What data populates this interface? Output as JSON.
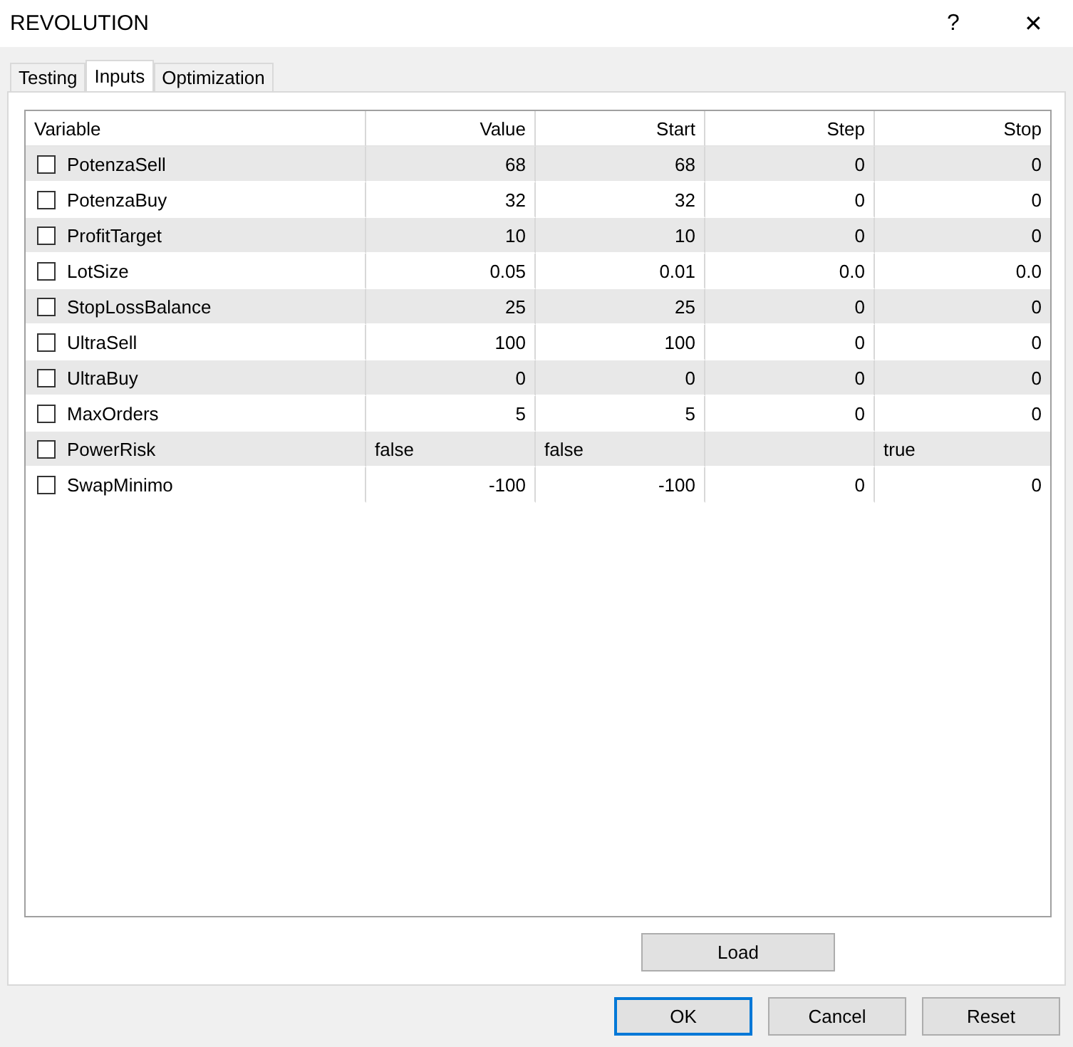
{
  "window": {
    "title": "REVOLUTION",
    "help": "?",
    "close": "✕"
  },
  "tabs": [
    {
      "label": "Testing",
      "selected": false
    },
    {
      "label": "Inputs",
      "selected": true
    },
    {
      "label": "Optimization",
      "selected": false
    }
  ],
  "table": {
    "columns": [
      "Variable",
      "Value",
      "Start",
      "Step",
      "Stop"
    ],
    "rows": [
      {
        "kind": "number",
        "checked": false,
        "variable": "PotenzaSell",
        "value": "68",
        "start": "68",
        "step": "0",
        "stop": "0"
      },
      {
        "kind": "number",
        "checked": false,
        "variable": "PotenzaBuy",
        "value": "32",
        "start": "32",
        "step": "0",
        "stop": "0"
      },
      {
        "kind": "number",
        "checked": false,
        "variable": "ProfitTarget",
        "value": "10",
        "start": "10",
        "step": "0",
        "stop": "0"
      },
      {
        "kind": "number",
        "checked": false,
        "variable": "LotSize",
        "value": "0.05",
        "start": "0.01",
        "step": "0.0",
        "stop": "0.0"
      },
      {
        "kind": "number",
        "checked": false,
        "variable": "StopLossBalance",
        "value": "25",
        "start": "25",
        "step": "0",
        "stop": "0"
      },
      {
        "kind": "number",
        "checked": false,
        "variable": "UltraSell",
        "value": "100",
        "start": "100",
        "step": "0",
        "stop": "0"
      },
      {
        "kind": "number",
        "checked": false,
        "variable": "UltraBuy",
        "value": "0",
        "start": "0",
        "step": "0",
        "stop": "0"
      },
      {
        "kind": "number",
        "checked": false,
        "variable": "MaxOrders",
        "value": "5",
        "start": "5",
        "step": "0",
        "stop": "0"
      },
      {
        "kind": "bool",
        "checked": false,
        "variable": "PowerRisk",
        "value": "false",
        "start": "false",
        "stop": "true"
      },
      {
        "kind": "number",
        "checked": false,
        "variable": "SwapMinimo",
        "value": "-100",
        "start": "-100",
        "step": "0",
        "stop": "0"
      }
    ]
  },
  "panel_buttons": [
    "Load"
  ],
  "buttons": [
    {
      "label": "OK",
      "default": true
    },
    {
      "label": "Cancel",
      "default": false
    },
    {
      "label": "Reset",
      "default": false
    }
  ]
}
